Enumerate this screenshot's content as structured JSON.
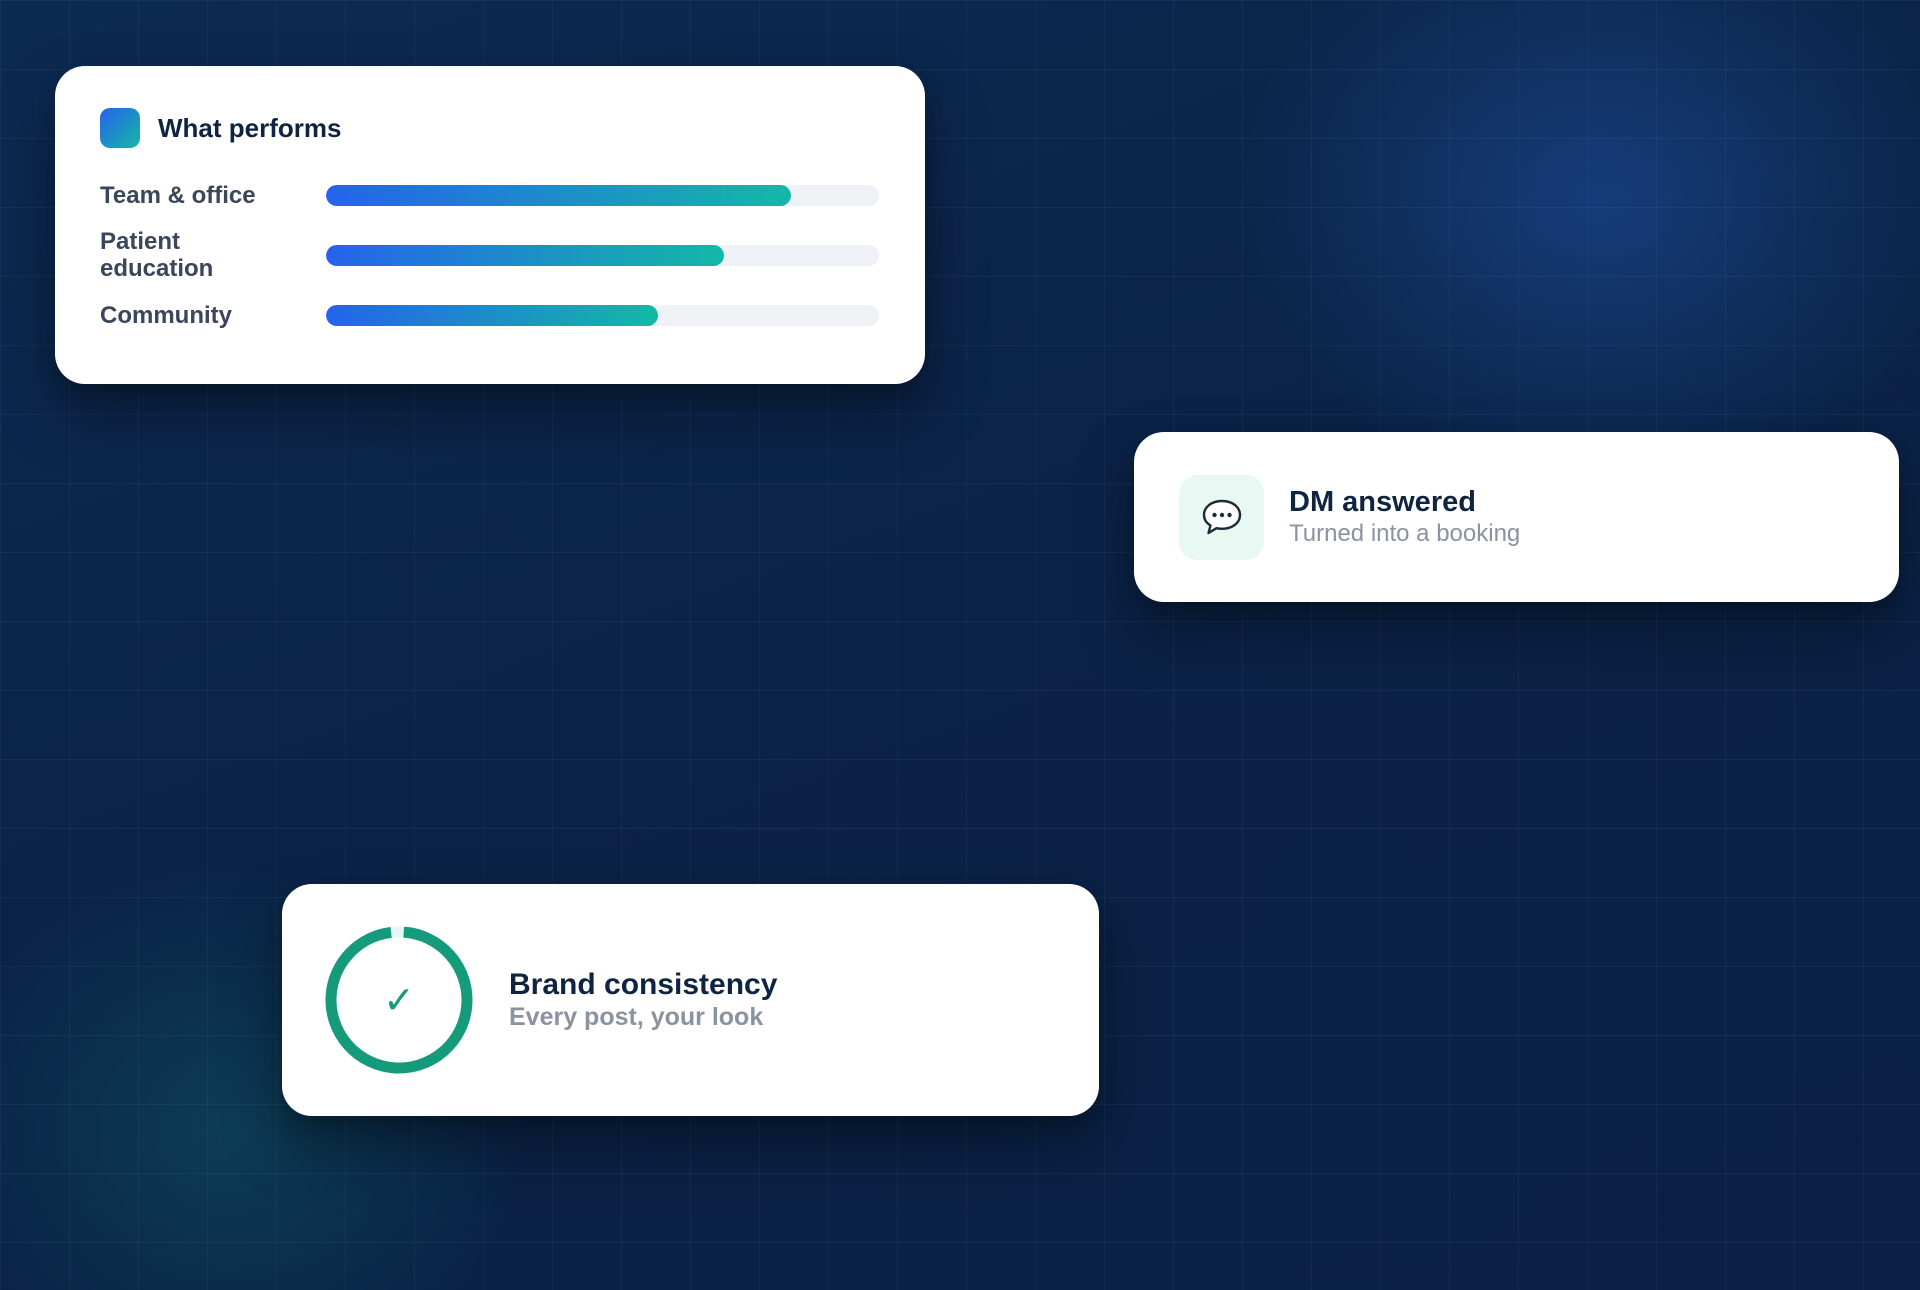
{
  "colors": {
    "gradient_start": "#2563eb",
    "gradient_end": "#14b8a6",
    "ring": "#159a7c",
    "title_text": "#0f2440",
    "muted_text": "#8a93a1"
  },
  "performance_card": {
    "title": "What performs",
    "logo_icon": "gradient-square-icon",
    "rows": [
      {
        "label": "Team & office",
        "value": 0.84
      },
      {
        "label": "Patient education",
        "value": 0.72
      },
      {
        "label": "Community",
        "value": 0.6
      }
    ]
  },
  "dm_card": {
    "icon": "speech-bubble-icon",
    "title": "DM answered",
    "subtitle": "Turned into a booking"
  },
  "brand_card": {
    "icon": "check-icon",
    "check_glyph": "✓",
    "progress": 0.97,
    "title": "Brand consistency",
    "subtitle": "Every post, your look"
  }
}
